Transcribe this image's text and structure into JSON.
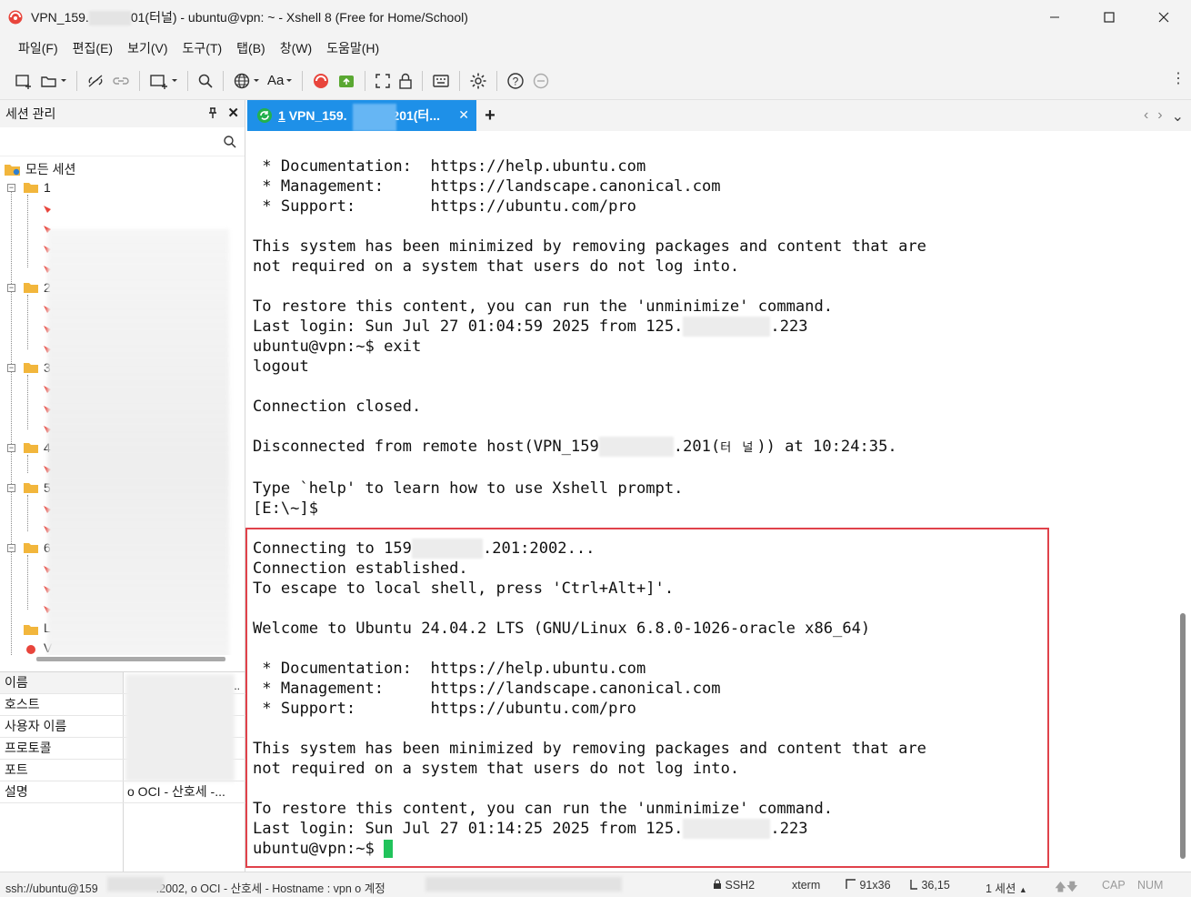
{
  "window": {
    "title_prefix": "VPN_159.",
    "title_suffix": "01(터널) - ubuntu@vpn: ~ - Xshell 8 (Free for Home/School)",
    "accent": "#1e90e8"
  },
  "menu": {
    "file": "파일(F)",
    "edit": "편집(E)",
    "view": "보기(V)",
    "tools": "도구(T)",
    "tab": "탭(B)",
    "window": "창(W)",
    "help": "도움말(H)"
  },
  "toolbar": {
    "font_label": "Aa"
  },
  "session_panel": {
    "title": "세션 관리",
    "root_label": "모든 세션",
    "folder_digits": [
      "1",
      "2",
      "3",
      "4",
      "5",
      "6",
      "L",
      "V"
    ]
  },
  "properties": {
    "header_key": "이름",
    "header_val": "..",
    "host": "호스트",
    "username": "사용자 이름",
    "protocol": "프로토콜",
    "port": "포트",
    "description": "설명",
    "description_value": "o OCI - 산호세 -..."
  },
  "tab": {
    "number": "1",
    "label_prefix": "VPN_159.",
    "label_suffix": ".201(터..."
  },
  "terminal": {
    "lines_block1": [
      " * Documentation:  https://help.ubuntu.com",
      " * Management:     https://landscape.canonical.com",
      " * Support:        https://ubuntu.com/pro",
      "",
      "This system has been minimized by removing packages and content that are",
      "not required on a system that users do not log into.",
      "",
      "To restore this content, you can run the 'unminimize' command."
    ],
    "last_login1_prefix": "Last login: Sun Jul 27 01:04:59 2025 from 125.",
    "last_login1_suffix": ".223",
    "lines_block2": [
      "ubuntu@vpn:~$ exit",
      "logout",
      "",
      "Connection closed.",
      ""
    ],
    "disconnected_prefix": "Disconnected from remote host(VPN_159",
    "disconnected_mid": ".201(",
    "disconnected_tunnel": "터 널",
    "disconnected_suffix": ")) at 10:24:35.",
    "lines_block3": [
      "",
      "Type `help' to learn how to use Xshell prompt.",
      "[E:\\~]$",
      ""
    ],
    "connecting_prefix": "Connecting to 159",
    "connecting_suffix": ".201:2002...",
    "lines_block4": [
      "Connection established.",
      "To escape to local shell, press 'Ctrl+Alt+]'.",
      "",
      "Welcome to Ubuntu 24.04.2 LTS (GNU/Linux 6.8.0-1026-oracle x86_64)",
      "",
      " * Documentation:  https://help.ubuntu.com",
      " * Management:     https://landscape.canonical.com",
      " * Support:        https://ubuntu.com/pro",
      "",
      "This system has been minimized by removing packages and content that are",
      "not required on a system that users do not log into.",
      "",
      "To restore this content, you can run the 'unminimize' command."
    ],
    "last_login2_prefix": "Last login: Sun Jul 27 01:14:25 2025 from 125.",
    "last_login2_suffix": ".223",
    "prompt": "ubuntu@vpn:~$ ",
    "cursor_color": "#21c35b",
    "highlight_color": "#e0424b"
  },
  "statusbar": {
    "conn_prefix": "ssh://ubuntu@159",
    "conn_suffix": ":2002, o OCI - 산호세 - Hostname : vpn o 계정",
    "protocol": "SSH2",
    "term": "xterm",
    "size": "91x36",
    "cursor_pos": "36,15",
    "sessions": "1 세션",
    "cap": "CAP",
    "num": "NUM"
  }
}
